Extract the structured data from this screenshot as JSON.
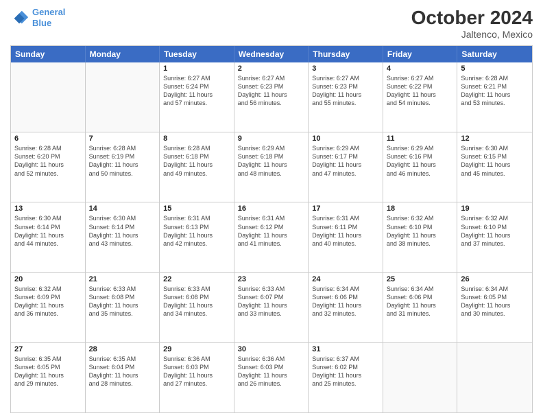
{
  "header": {
    "logo_line1": "General",
    "logo_line2": "Blue",
    "month": "October 2024",
    "location": "Jaltenco, Mexico"
  },
  "weekdays": [
    "Sunday",
    "Monday",
    "Tuesday",
    "Wednesday",
    "Thursday",
    "Friday",
    "Saturday"
  ],
  "rows": [
    [
      {
        "day": "",
        "lines": []
      },
      {
        "day": "",
        "lines": []
      },
      {
        "day": "1",
        "lines": [
          "Sunrise: 6:27 AM",
          "Sunset: 6:24 PM",
          "Daylight: 11 hours",
          "and 57 minutes."
        ]
      },
      {
        "day": "2",
        "lines": [
          "Sunrise: 6:27 AM",
          "Sunset: 6:23 PM",
          "Daylight: 11 hours",
          "and 56 minutes."
        ]
      },
      {
        "day": "3",
        "lines": [
          "Sunrise: 6:27 AM",
          "Sunset: 6:23 PM",
          "Daylight: 11 hours",
          "and 55 minutes."
        ]
      },
      {
        "day": "4",
        "lines": [
          "Sunrise: 6:27 AM",
          "Sunset: 6:22 PM",
          "Daylight: 11 hours",
          "and 54 minutes."
        ]
      },
      {
        "day": "5",
        "lines": [
          "Sunrise: 6:28 AM",
          "Sunset: 6:21 PM",
          "Daylight: 11 hours",
          "and 53 minutes."
        ]
      }
    ],
    [
      {
        "day": "6",
        "lines": [
          "Sunrise: 6:28 AM",
          "Sunset: 6:20 PM",
          "Daylight: 11 hours",
          "and 52 minutes."
        ]
      },
      {
        "day": "7",
        "lines": [
          "Sunrise: 6:28 AM",
          "Sunset: 6:19 PM",
          "Daylight: 11 hours",
          "and 50 minutes."
        ]
      },
      {
        "day": "8",
        "lines": [
          "Sunrise: 6:28 AM",
          "Sunset: 6:18 PM",
          "Daylight: 11 hours",
          "and 49 minutes."
        ]
      },
      {
        "day": "9",
        "lines": [
          "Sunrise: 6:29 AM",
          "Sunset: 6:18 PM",
          "Daylight: 11 hours",
          "and 48 minutes."
        ]
      },
      {
        "day": "10",
        "lines": [
          "Sunrise: 6:29 AM",
          "Sunset: 6:17 PM",
          "Daylight: 11 hours",
          "and 47 minutes."
        ]
      },
      {
        "day": "11",
        "lines": [
          "Sunrise: 6:29 AM",
          "Sunset: 6:16 PM",
          "Daylight: 11 hours",
          "and 46 minutes."
        ]
      },
      {
        "day": "12",
        "lines": [
          "Sunrise: 6:30 AM",
          "Sunset: 6:15 PM",
          "Daylight: 11 hours",
          "and 45 minutes."
        ]
      }
    ],
    [
      {
        "day": "13",
        "lines": [
          "Sunrise: 6:30 AM",
          "Sunset: 6:14 PM",
          "Daylight: 11 hours",
          "and 44 minutes."
        ]
      },
      {
        "day": "14",
        "lines": [
          "Sunrise: 6:30 AM",
          "Sunset: 6:14 PM",
          "Daylight: 11 hours",
          "and 43 minutes."
        ]
      },
      {
        "day": "15",
        "lines": [
          "Sunrise: 6:31 AM",
          "Sunset: 6:13 PM",
          "Daylight: 11 hours",
          "and 42 minutes."
        ]
      },
      {
        "day": "16",
        "lines": [
          "Sunrise: 6:31 AM",
          "Sunset: 6:12 PM",
          "Daylight: 11 hours",
          "and 41 minutes."
        ]
      },
      {
        "day": "17",
        "lines": [
          "Sunrise: 6:31 AM",
          "Sunset: 6:11 PM",
          "Daylight: 11 hours",
          "and 40 minutes."
        ]
      },
      {
        "day": "18",
        "lines": [
          "Sunrise: 6:32 AM",
          "Sunset: 6:10 PM",
          "Daylight: 11 hours",
          "and 38 minutes."
        ]
      },
      {
        "day": "19",
        "lines": [
          "Sunrise: 6:32 AM",
          "Sunset: 6:10 PM",
          "Daylight: 11 hours",
          "and 37 minutes."
        ]
      }
    ],
    [
      {
        "day": "20",
        "lines": [
          "Sunrise: 6:32 AM",
          "Sunset: 6:09 PM",
          "Daylight: 11 hours",
          "and 36 minutes."
        ]
      },
      {
        "day": "21",
        "lines": [
          "Sunrise: 6:33 AM",
          "Sunset: 6:08 PM",
          "Daylight: 11 hours",
          "and 35 minutes."
        ]
      },
      {
        "day": "22",
        "lines": [
          "Sunrise: 6:33 AM",
          "Sunset: 6:08 PM",
          "Daylight: 11 hours",
          "and 34 minutes."
        ]
      },
      {
        "day": "23",
        "lines": [
          "Sunrise: 6:33 AM",
          "Sunset: 6:07 PM",
          "Daylight: 11 hours",
          "and 33 minutes."
        ]
      },
      {
        "day": "24",
        "lines": [
          "Sunrise: 6:34 AM",
          "Sunset: 6:06 PM",
          "Daylight: 11 hours",
          "and 32 minutes."
        ]
      },
      {
        "day": "25",
        "lines": [
          "Sunrise: 6:34 AM",
          "Sunset: 6:06 PM",
          "Daylight: 11 hours",
          "and 31 minutes."
        ]
      },
      {
        "day": "26",
        "lines": [
          "Sunrise: 6:34 AM",
          "Sunset: 6:05 PM",
          "Daylight: 11 hours",
          "and 30 minutes."
        ]
      }
    ],
    [
      {
        "day": "27",
        "lines": [
          "Sunrise: 6:35 AM",
          "Sunset: 6:05 PM",
          "Daylight: 11 hours",
          "and 29 minutes."
        ]
      },
      {
        "day": "28",
        "lines": [
          "Sunrise: 6:35 AM",
          "Sunset: 6:04 PM",
          "Daylight: 11 hours",
          "and 28 minutes."
        ]
      },
      {
        "day": "29",
        "lines": [
          "Sunrise: 6:36 AM",
          "Sunset: 6:03 PM",
          "Daylight: 11 hours",
          "and 27 minutes."
        ]
      },
      {
        "day": "30",
        "lines": [
          "Sunrise: 6:36 AM",
          "Sunset: 6:03 PM",
          "Daylight: 11 hours",
          "and 26 minutes."
        ]
      },
      {
        "day": "31",
        "lines": [
          "Sunrise: 6:37 AM",
          "Sunset: 6:02 PM",
          "Daylight: 11 hours",
          "and 25 minutes."
        ]
      },
      {
        "day": "",
        "lines": []
      },
      {
        "day": "",
        "lines": []
      }
    ]
  ]
}
